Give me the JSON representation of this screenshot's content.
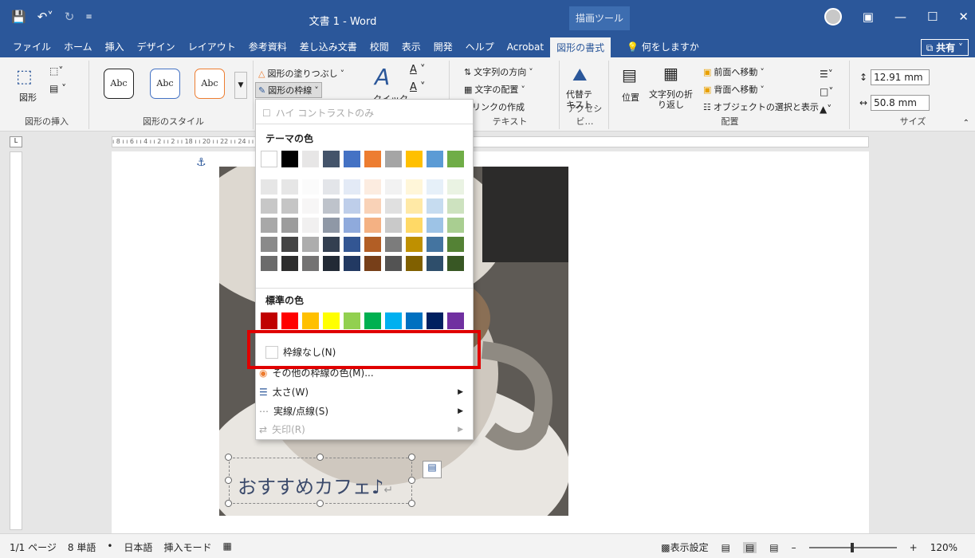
{
  "window": {
    "title": "文書 1  -  Word",
    "drawing_tools": "描画ツール"
  },
  "tabs": [
    "ファイル",
    "ホーム",
    "挿入",
    "デザイン",
    "レイアウト",
    "参考資料",
    "差し込み文書",
    "校閲",
    "表示",
    "開発",
    "ヘルプ",
    "Acrobat",
    "図形の書式"
  ],
  "active_tab": "図形の書式",
  "tell_me": "何をしますか",
  "share": "共有",
  "ribbon": {
    "insert_shapes": {
      "shape_label": "図形",
      "group_label": "図形の挿入"
    },
    "shape_styles": {
      "abc": "Abc",
      "group_label": "図形のスタイル",
      "fill": "図形の塗りつぶし",
      "outline": "図形の枠線"
    },
    "wordart": {
      "quick": "クイック"
    },
    "text": {
      "direction": "文字列の方向",
      "align": "文字の配置",
      "link": "リンクの作成",
      "group_label": "テキスト"
    },
    "accessibility": {
      "alt_text": "代替テ\nキスト",
      "group_label": "アクセシビ…"
    },
    "arrange": {
      "position": "位置",
      "wrap": "文字列の折\nり返し",
      "front": "前面へ移動",
      "back": "背面へ移動",
      "selection": "オブジェクトの選択と表示",
      "group_label": "配置"
    },
    "size": {
      "height": "12.91 mm",
      "width": "50.8 mm",
      "group_label": "サイズ"
    }
  },
  "ruler": {
    "ticks": "ı 8 ı  ı 6 ı  ı 4 ı  ı 2 ı        ı 2 ı                                                     ı 18 ı  ı 20 ı  ı 22 ı  ı 24 ı  ı 26 ı  ı 28 ı  ı 30 ı  ı 32 ı  ı 34 ı  ı 36 ı  ı 38 ı  ı 40 ı  ı 42 ı  ı 44 ı  ı 46 ı",
    "corner": "L"
  },
  "dropdown": {
    "high_contrast": "ハイ コントラストのみ",
    "theme_colors": "テーマの色",
    "standard_colors": "標準の色",
    "no_outline": "枠線なし(N)",
    "more_colors": "その他の枠線の色(M)...",
    "weight": "太さ(W)",
    "dashes": "実線/点線(S)",
    "arrows": "矢印(R)",
    "theme_swatches": [
      "#ffffff",
      "#000000",
      "#e7e6e6",
      "#44546a",
      "#4472c4",
      "#ed7d31",
      "#a5a5a5",
      "#ffc000",
      "#5b9bd5",
      "#70ad47"
    ],
    "standard_swatches": [
      "#c00000",
      "#ff0000",
      "#ffc000",
      "#ffff00",
      "#92d050",
      "#00b050",
      "#00b0f0",
      "#0070c0",
      "#002060",
      "#7030a0"
    ]
  },
  "document": {
    "textbox_text": "おすすめカフェ♪"
  },
  "status": {
    "page": "1/1 ページ",
    "words": "8 単語",
    "language": "日本語",
    "mode": "挿入モード",
    "display_settings": "表示設定",
    "zoom": "120%"
  }
}
